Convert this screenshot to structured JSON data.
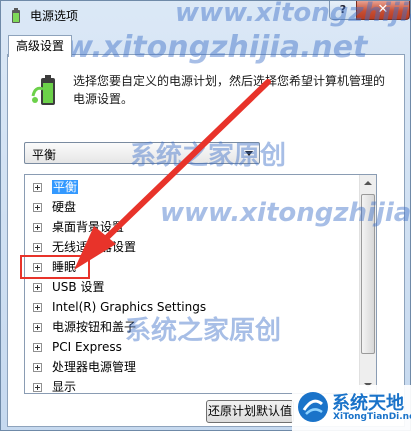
{
  "window": {
    "title": "电源选项",
    "help_label": "?",
    "close_label": "✕"
  },
  "tab": {
    "label": "高级设置"
  },
  "description": "选择您要自定义的电源计划，然后选择您希望计算机管理的电源设置。",
  "plan_select": {
    "value": "平衡"
  },
  "tree_items": [
    {
      "label": "平衡",
      "selected": true
    },
    {
      "label": "硬盘",
      "selected": false
    },
    {
      "label": "桌面背景设置",
      "selected": false
    },
    {
      "label": "无线适配器设置",
      "selected": false
    },
    {
      "label": "睡眠",
      "selected": false
    },
    {
      "label": "USB 设置",
      "selected": false
    },
    {
      "label": "Intel(R) Graphics Settings",
      "selected": false
    },
    {
      "label": "电源按钮和盖子",
      "selected": false
    },
    {
      "label": "PCI Express",
      "selected": false
    },
    {
      "label": "处理器电源管理",
      "selected": false
    },
    {
      "label": "显示",
      "selected": false
    }
  ],
  "buttons": {
    "restore_label": "还原计划默认值"
  },
  "watermarks": {
    "url_1": "www.xitongzhijia.net",
    "url_2": "www.xitongzhijia.net",
    "url_3": "www.xitongzhijia.net",
    "site_name_1": "系统之家原创",
    "site_name_2": "系统之家原创"
  },
  "logo": {
    "name": "系统天地",
    "url": "XiTongTianDi.net"
  },
  "colors": {
    "selection": "#3399ff",
    "close": "#c74f34",
    "arrow": "#e8332a",
    "logo": "#1a73c9"
  }
}
